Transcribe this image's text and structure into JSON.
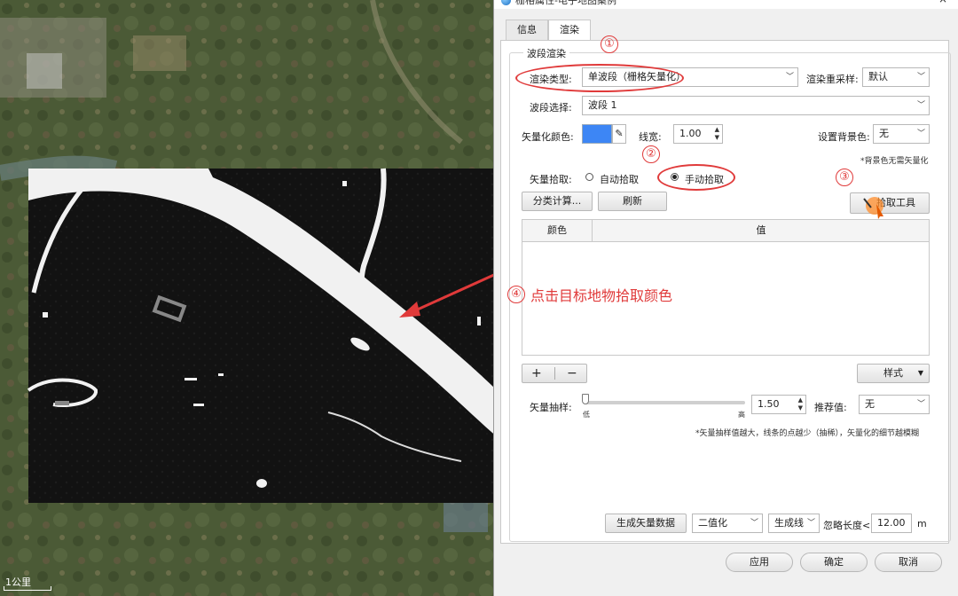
{
  "window": {
    "title": "栅格属性-电子地图案例",
    "close": "×"
  },
  "tabs": [
    {
      "label": "信息"
    },
    {
      "label": "渲染"
    }
  ],
  "group_title": "波段渲染",
  "render_type": {
    "label": "渲染类型:",
    "value": "单波段（栅格矢量化）"
  },
  "resample": {
    "label": "渲染重采样:",
    "value": "默认"
  },
  "band": {
    "label": "波段选择:",
    "value": "波段 1"
  },
  "vector_color": {
    "label": "矢量化颜色:",
    "color": "#3d86f5",
    "picker_icon": "eyedropper-icon"
  },
  "line_width": {
    "label": "线宽:",
    "value": "1.00"
  },
  "background": {
    "label": "设置背景色:",
    "value": "无",
    "note": "*背景色无需矢量化"
  },
  "pick": {
    "label": "矢量拾取:",
    "auto": "自动拾取",
    "manual": "手动拾取",
    "selected": "manual"
  },
  "buttons": {
    "classify": "分类计算...",
    "refresh": "刷新",
    "pick_tool": "拾取工具",
    "style": "样式",
    "generate": "生成矢量数据",
    "apply": "应用",
    "ok": "确定",
    "cancel": "取消",
    "add": "+",
    "remove": "−"
  },
  "table": {
    "headers": [
      "颜色",
      "值"
    ]
  },
  "sampling": {
    "label": "矢量抽样:",
    "low": "低",
    "high": "高",
    "value": "1.50",
    "level": 0.0,
    "recommend_label": "推荐值:",
    "recommend_value": "无",
    "note": "*矢量抽样值越大，线条的点越少（抽稀），矢量化的细节越模糊"
  },
  "output": {
    "mode": "二值化",
    "geometry": "生成线",
    "ignore_label": "忽略长度<",
    "ignore_value": "12.00",
    "unit": "m"
  },
  "annotations": {
    "n1": "①",
    "n2": "②",
    "n3": "③",
    "n4": "④",
    "callout": "点击目标地物拾取颜色",
    "accent": "#e03a3a"
  },
  "scalebar": {
    "label": "1公里"
  }
}
